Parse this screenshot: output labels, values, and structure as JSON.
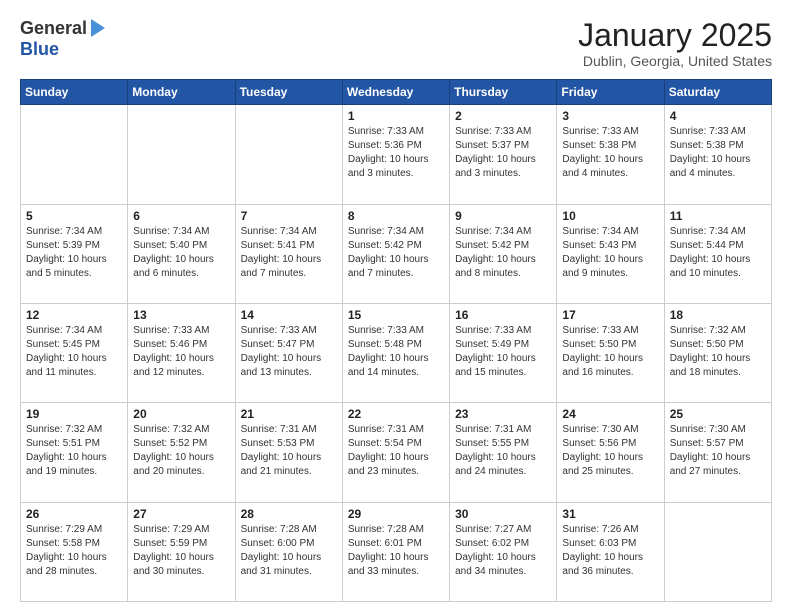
{
  "logo": {
    "general": "General",
    "blue": "Blue"
  },
  "header": {
    "month": "January 2025",
    "location": "Dublin, Georgia, United States"
  },
  "weekdays": [
    "Sunday",
    "Monday",
    "Tuesday",
    "Wednesday",
    "Thursday",
    "Friday",
    "Saturday"
  ],
  "weeks": [
    [
      {
        "day": "",
        "empty": true
      },
      {
        "day": "",
        "empty": true
      },
      {
        "day": "",
        "empty": true
      },
      {
        "day": "1",
        "sunrise": "7:33 AM",
        "sunset": "5:36 PM",
        "daylight": "10 hours and 3 minutes."
      },
      {
        "day": "2",
        "sunrise": "7:33 AM",
        "sunset": "5:37 PM",
        "daylight": "10 hours and 3 minutes."
      },
      {
        "day": "3",
        "sunrise": "7:33 AM",
        "sunset": "5:38 PM",
        "daylight": "10 hours and 4 minutes."
      },
      {
        "day": "4",
        "sunrise": "7:33 AM",
        "sunset": "5:38 PM",
        "daylight": "10 hours and 4 minutes."
      }
    ],
    [
      {
        "day": "5",
        "sunrise": "7:34 AM",
        "sunset": "5:39 PM",
        "daylight": "10 hours and 5 minutes."
      },
      {
        "day": "6",
        "sunrise": "7:34 AM",
        "sunset": "5:40 PM",
        "daylight": "10 hours and 6 minutes."
      },
      {
        "day": "7",
        "sunrise": "7:34 AM",
        "sunset": "5:41 PM",
        "daylight": "10 hours and 7 minutes."
      },
      {
        "day": "8",
        "sunrise": "7:34 AM",
        "sunset": "5:42 PM",
        "daylight": "10 hours and 7 minutes."
      },
      {
        "day": "9",
        "sunrise": "7:34 AM",
        "sunset": "5:42 PM",
        "daylight": "10 hours and 8 minutes."
      },
      {
        "day": "10",
        "sunrise": "7:34 AM",
        "sunset": "5:43 PM",
        "daylight": "10 hours and 9 minutes."
      },
      {
        "day": "11",
        "sunrise": "7:34 AM",
        "sunset": "5:44 PM",
        "daylight": "10 hours and 10 minutes."
      }
    ],
    [
      {
        "day": "12",
        "sunrise": "7:34 AM",
        "sunset": "5:45 PM",
        "daylight": "10 hours and 11 minutes."
      },
      {
        "day": "13",
        "sunrise": "7:33 AM",
        "sunset": "5:46 PM",
        "daylight": "10 hours and 12 minutes."
      },
      {
        "day": "14",
        "sunrise": "7:33 AM",
        "sunset": "5:47 PM",
        "daylight": "10 hours and 13 minutes."
      },
      {
        "day": "15",
        "sunrise": "7:33 AM",
        "sunset": "5:48 PM",
        "daylight": "10 hours and 14 minutes."
      },
      {
        "day": "16",
        "sunrise": "7:33 AM",
        "sunset": "5:49 PM",
        "daylight": "10 hours and 15 minutes."
      },
      {
        "day": "17",
        "sunrise": "7:33 AM",
        "sunset": "5:50 PM",
        "daylight": "10 hours and 16 minutes."
      },
      {
        "day": "18",
        "sunrise": "7:32 AM",
        "sunset": "5:50 PM",
        "daylight": "10 hours and 18 minutes."
      }
    ],
    [
      {
        "day": "19",
        "sunrise": "7:32 AM",
        "sunset": "5:51 PM",
        "daylight": "10 hours and 19 minutes."
      },
      {
        "day": "20",
        "sunrise": "7:32 AM",
        "sunset": "5:52 PM",
        "daylight": "10 hours and 20 minutes."
      },
      {
        "day": "21",
        "sunrise": "7:31 AM",
        "sunset": "5:53 PM",
        "daylight": "10 hours and 21 minutes."
      },
      {
        "day": "22",
        "sunrise": "7:31 AM",
        "sunset": "5:54 PM",
        "daylight": "10 hours and 23 minutes."
      },
      {
        "day": "23",
        "sunrise": "7:31 AM",
        "sunset": "5:55 PM",
        "daylight": "10 hours and 24 minutes."
      },
      {
        "day": "24",
        "sunrise": "7:30 AM",
        "sunset": "5:56 PM",
        "daylight": "10 hours and 25 minutes."
      },
      {
        "day": "25",
        "sunrise": "7:30 AM",
        "sunset": "5:57 PM",
        "daylight": "10 hours and 27 minutes."
      }
    ],
    [
      {
        "day": "26",
        "sunrise": "7:29 AM",
        "sunset": "5:58 PM",
        "daylight": "10 hours and 28 minutes."
      },
      {
        "day": "27",
        "sunrise": "7:29 AM",
        "sunset": "5:59 PM",
        "daylight": "10 hours and 30 minutes."
      },
      {
        "day": "28",
        "sunrise": "7:28 AM",
        "sunset": "6:00 PM",
        "daylight": "10 hours and 31 minutes."
      },
      {
        "day": "29",
        "sunrise": "7:28 AM",
        "sunset": "6:01 PM",
        "daylight": "10 hours and 33 minutes."
      },
      {
        "day": "30",
        "sunrise": "7:27 AM",
        "sunset": "6:02 PM",
        "daylight": "10 hours and 34 minutes."
      },
      {
        "day": "31",
        "sunrise": "7:26 AM",
        "sunset": "6:03 PM",
        "daylight": "10 hours and 36 minutes."
      },
      {
        "day": "",
        "empty": true
      }
    ]
  ]
}
